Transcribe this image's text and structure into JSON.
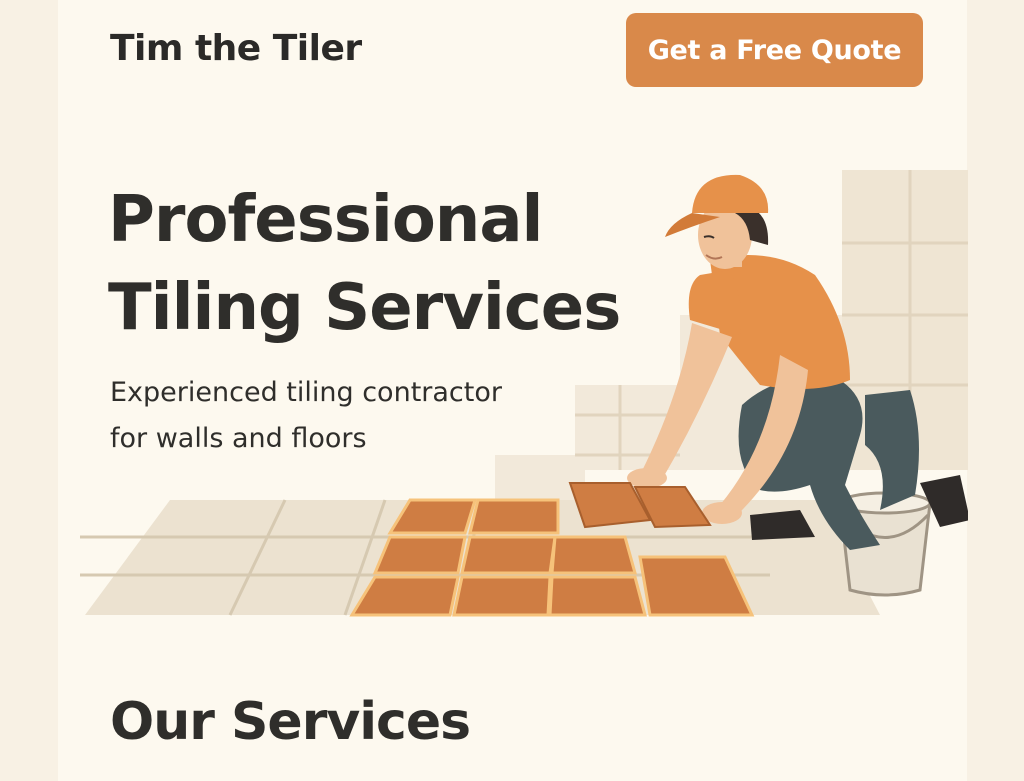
{
  "header": {
    "brand": "Tim the Tiler",
    "cta_label": "Get a Free Quote"
  },
  "hero": {
    "title_line1": "Professional",
    "title_line2": "Tiling Services",
    "subtitle_line1": "Experienced tiling contractor",
    "subtitle_line2": "for walls and floors",
    "illustration_icon": "tiler-laying-floor-tiles"
  },
  "services": {
    "title": "Our Services"
  },
  "colors": {
    "accent": "#d9894a",
    "page_background": "#fdf9ef",
    "outer_background": "#f8f1e4",
    "text": "#2f2e2b",
    "tile_terracotta": "#cf7d43",
    "tile_cream": "#ece2d0"
  }
}
